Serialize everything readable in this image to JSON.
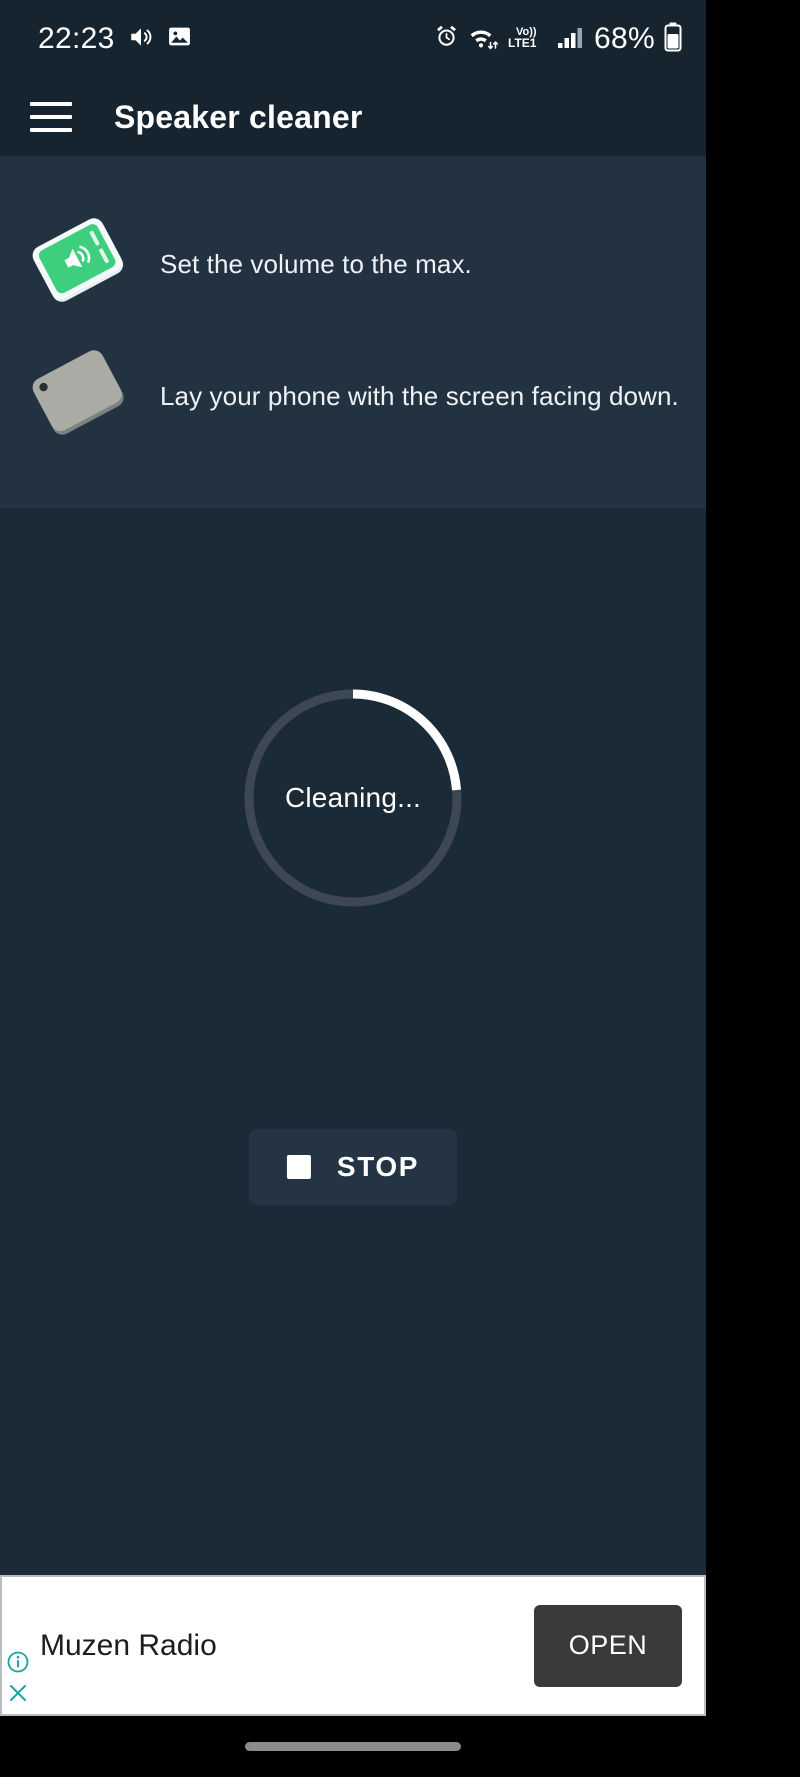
{
  "status_bar": {
    "time": "22:23",
    "left_icons": [
      "volume-icon",
      "image-icon"
    ],
    "right_icons": [
      "alarm-icon",
      "wifi-icon",
      "volte-lte-icon",
      "signal-bars-icon",
      "battery-icon"
    ],
    "network_label": "Vo)) LTE1",
    "battery_percent": "68%"
  },
  "app_bar": {
    "menu_icon": "hamburger-menu-icon",
    "title": "Speaker cleaner"
  },
  "instructions": [
    {
      "icon": "phone-volume-max-icon",
      "text": "Set the volume to the max."
    },
    {
      "icon": "phone-face-down-icon",
      "text": "Lay your phone with the screen facing down."
    }
  ],
  "progress": {
    "status_text": "Cleaning...",
    "percent": 25,
    "track_color": "#3d4854",
    "arc_color": "#ffffff"
  },
  "stop_button": {
    "icon": "stop-square-icon",
    "label": "STOP"
  },
  "ad": {
    "title": "Muzen Radio",
    "open_label": "OPEN",
    "info_icon": "ad-info-icon",
    "close_icon": "ad-close-icon",
    "accent_color": "#1aa3a3"
  },
  "navigation": {
    "pill": "home-gesture-pill"
  },
  "colors": {
    "status_bg": "#16242f",
    "instructions_bg": "#223241",
    "main_bg": "#1b2a37",
    "accent_green": "#3ecf7e"
  }
}
